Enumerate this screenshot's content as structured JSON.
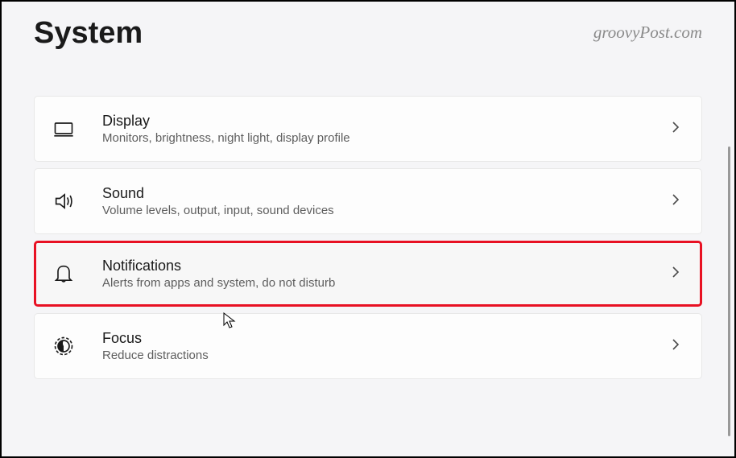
{
  "header": {
    "title": "System",
    "watermark": "groovyPost.com"
  },
  "items": [
    {
      "id": "display",
      "title": "Display",
      "desc": "Monitors, brightness, night light, display profile",
      "highlighted": false
    },
    {
      "id": "sound",
      "title": "Sound",
      "desc": "Volume levels, output, input, sound devices",
      "highlighted": false
    },
    {
      "id": "notifications",
      "title": "Notifications",
      "desc": "Alerts from apps and system, do not disturb",
      "highlighted": true
    },
    {
      "id": "focus",
      "title": "Focus",
      "desc": "Reduce distractions",
      "highlighted": false
    }
  ]
}
